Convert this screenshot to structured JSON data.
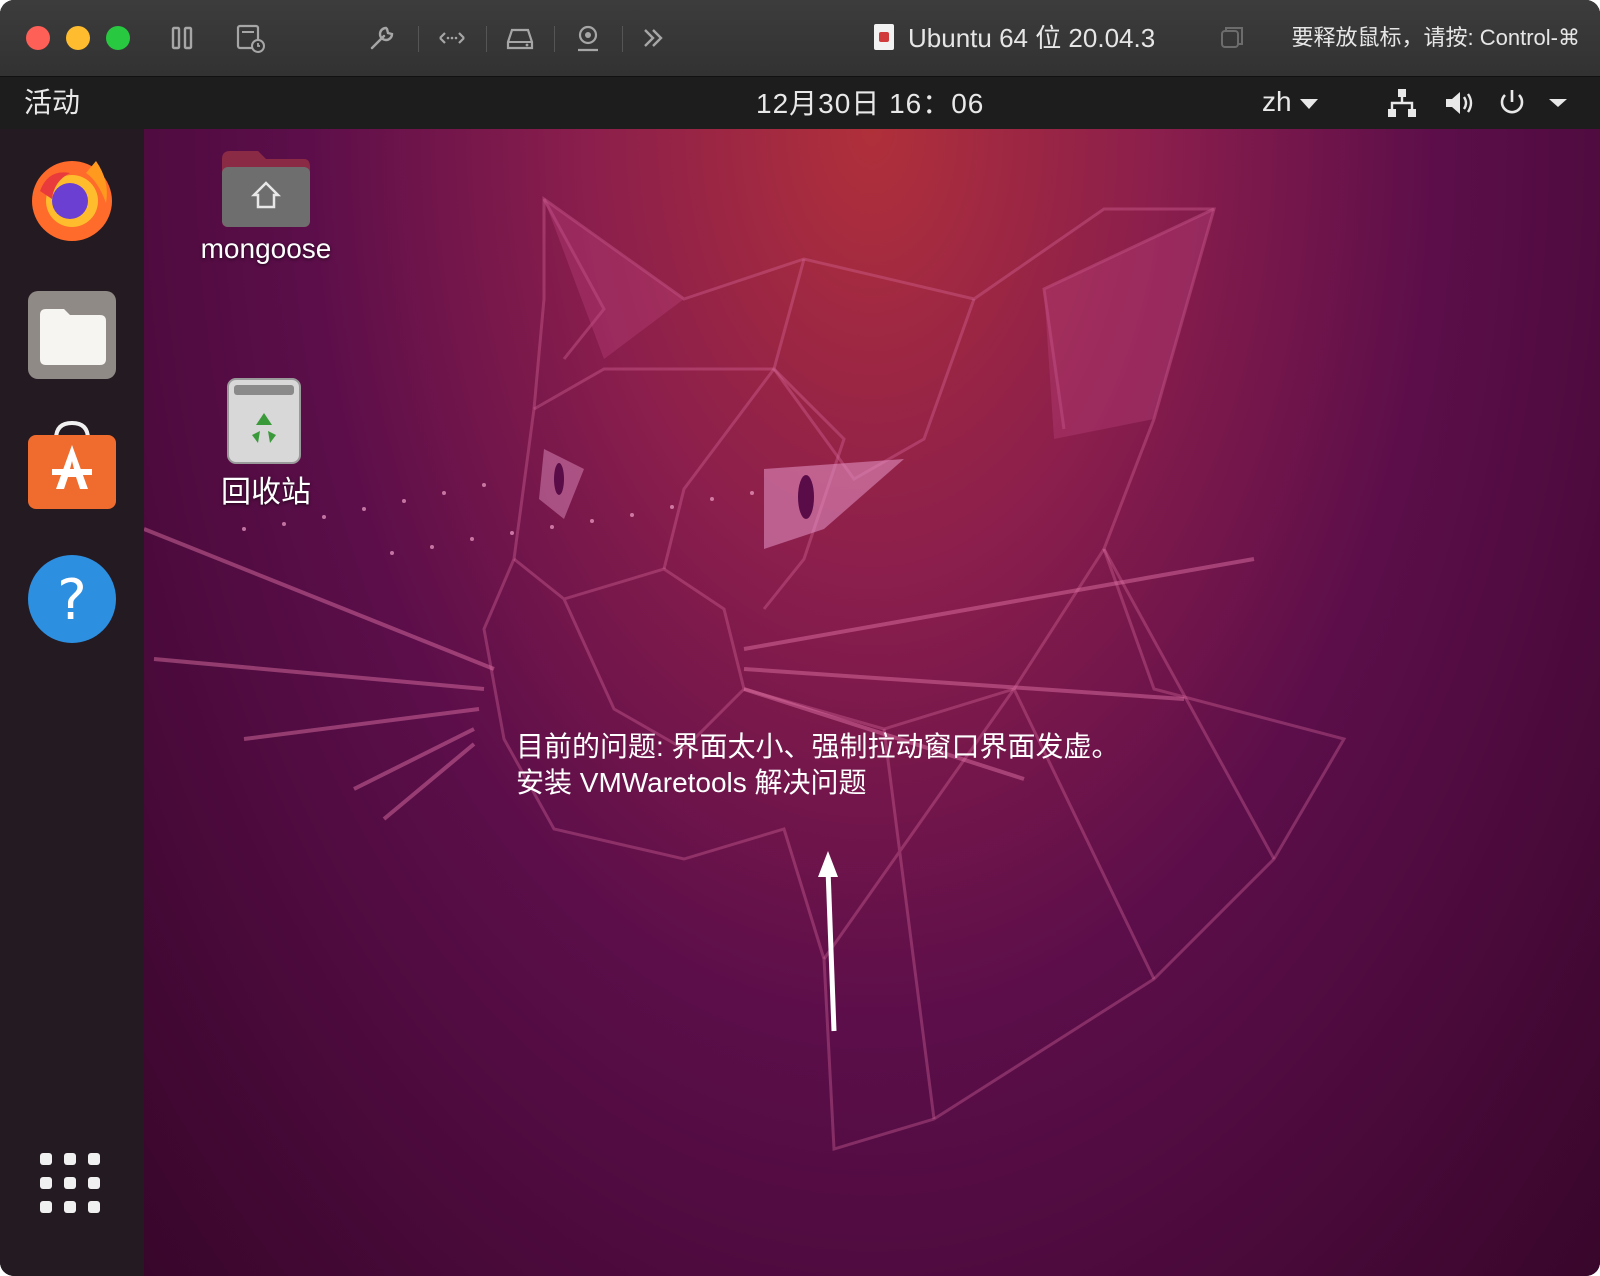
{
  "titlebar": {
    "vm_title": "Ubuntu 64 位 20.04.3",
    "release_hint": "要释放鼠标，请按: Control-⌘"
  },
  "topbar": {
    "activities": "活动",
    "clock": "12月30日  16：06",
    "language": "zh"
  },
  "dock": {
    "items": [
      "firefox-icon",
      "files-icon",
      "software-center-icon",
      "help-icon",
      "show-apps-icon"
    ]
  },
  "desktop": {
    "home_folder_label": "mongoose",
    "trash_label": "回收站",
    "note_line1": "目前的问题: 界面太小、强制拉动窗口界面发虚。",
    "note_line2": "安装 VMWaretools 解决问题"
  },
  "colors": {
    "wallpaper_top": "#b0303a",
    "wallpaper_bottom": "#38062b",
    "dock_bg": "#241a21",
    "topbar_bg": "#1d1d1d"
  }
}
